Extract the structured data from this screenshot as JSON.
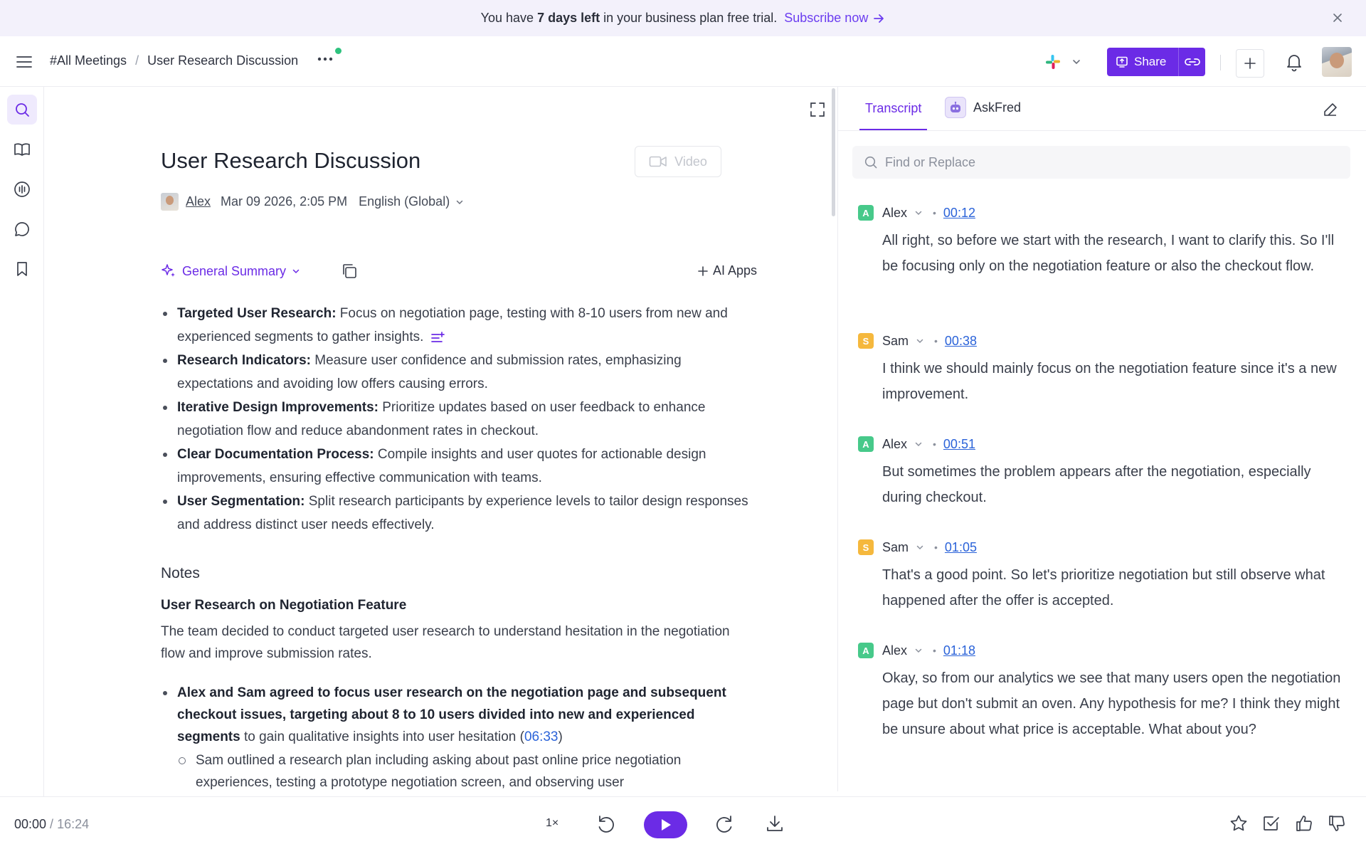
{
  "banner": {
    "text_before": "You have ",
    "text_bold": "7 days left",
    "text_after": " in your business plan free trial.",
    "subscribe": "Subscribe now"
  },
  "header": {
    "breadcrumb_root": "#All Meetings",
    "breadcrumb_sep": "/",
    "breadcrumb_current": "User Research Discussion",
    "share_label": "Share"
  },
  "doc": {
    "title": "User Research Discussion",
    "video_label": "Video",
    "author": "Alex",
    "date": "Mar 09 2026, 2:05 PM",
    "language": "English (Global)",
    "summary_selector": "General Summary",
    "ai_apps": "AI Apps",
    "summary": [
      {
        "title": "Targeted User Research:",
        "text": " Focus on negotiation page, testing with 8-10 users from new and experienced segments to gather insights."
      },
      {
        "title": "Research Indicators:",
        "text": " Measure user confidence and submission rates, emphasizing expectations and avoiding low offers causing errors."
      },
      {
        "title": "Iterative Design Improvements:",
        "text": " Prioritize updates based on user feedback to enhance negotiation flow and reduce abandonment rates in checkout."
      },
      {
        "title": "Clear Documentation Process:",
        "text": " Compile insights and user quotes for actionable design improvements, ensuring effective communication with teams."
      },
      {
        "title": "User Segmentation:",
        "text": " Split research participants by experience levels to tailor design responses and address distinct user needs effectively."
      }
    ],
    "notes_heading": "Notes",
    "notes_subheading": "User Research on Negotiation Feature",
    "notes_paragraph": "The team decided to conduct targeted user research to understand hesitation in the negotiation flow and improve submission rates.",
    "notes_bullet_bold": "Alex and Sam agreed to focus user research on the negotiation page and subsequent checkout issues, targeting about 8 to 10 users divided into new and experienced segments",
    "notes_bullet_rest": " to gain qualitative insights into user hesitation (",
    "notes_bullet_ts": "06:33",
    "notes_bullet_close": ")",
    "notes_sub_bullet": "Sam outlined a research plan including asking about past online price negotiation",
    "notes_sub_bullet_cont": "experiences, testing a prototype negotiation screen, and observing user"
  },
  "transcript": {
    "tab_transcript": "Transcript",
    "tab_askfred": "AskFred",
    "find_placeholder": "Find or Replace",
    "segments": [
      {
        "initial": "A",
        "speaker": "Alex",
        "time": "00:12",
        "text": "All right, so before we start with the research, I want to clarify this. So I'll be focusing only on the negotiation feature or also the checkout flow."
      },
      {
        "initial": "S",
        "speaker": "Sam",
        "time": "00:38",
        "text": "I think we should mainly focus on the negotiation feature since it's a new improvement."
      },
      {
        "initial": "A",
        "speaker": "Alex",
        "time": "00:51",
        "text": "But sometimes the problem appears after the negotiation, especially during checkout."
      },
      {
        "initial": "S",
        "speaker": "Sam",
        "time": "01:05",
        "text": "That's a good point. So let's prioritize negotiation but still observe what happened after the offer is accepted."
      },
      {
        "initial": "A",
        "speaker": "Alex",
        "time": "01:18",
        "text": "Okay, so from our analytics we see that many users open the negotiation page but don't submit an oven. Any hypothesis for me? I think they might be unsure about what price is acceptable. What about you?"
      }
    ]
  },
  "player": {
    "current": "00:00",
    "sep": " / ",
    "duration": "16:24",
    "speed": "1×"
  },
  "colors": {
    "accent": "#6b2be6",
    "link": "#2b63d9",
    "alex_badge": "#47c98a",
    "sam_badge": "#f5b83d",
    "online_dot": "#2ec27e"
  }
}
